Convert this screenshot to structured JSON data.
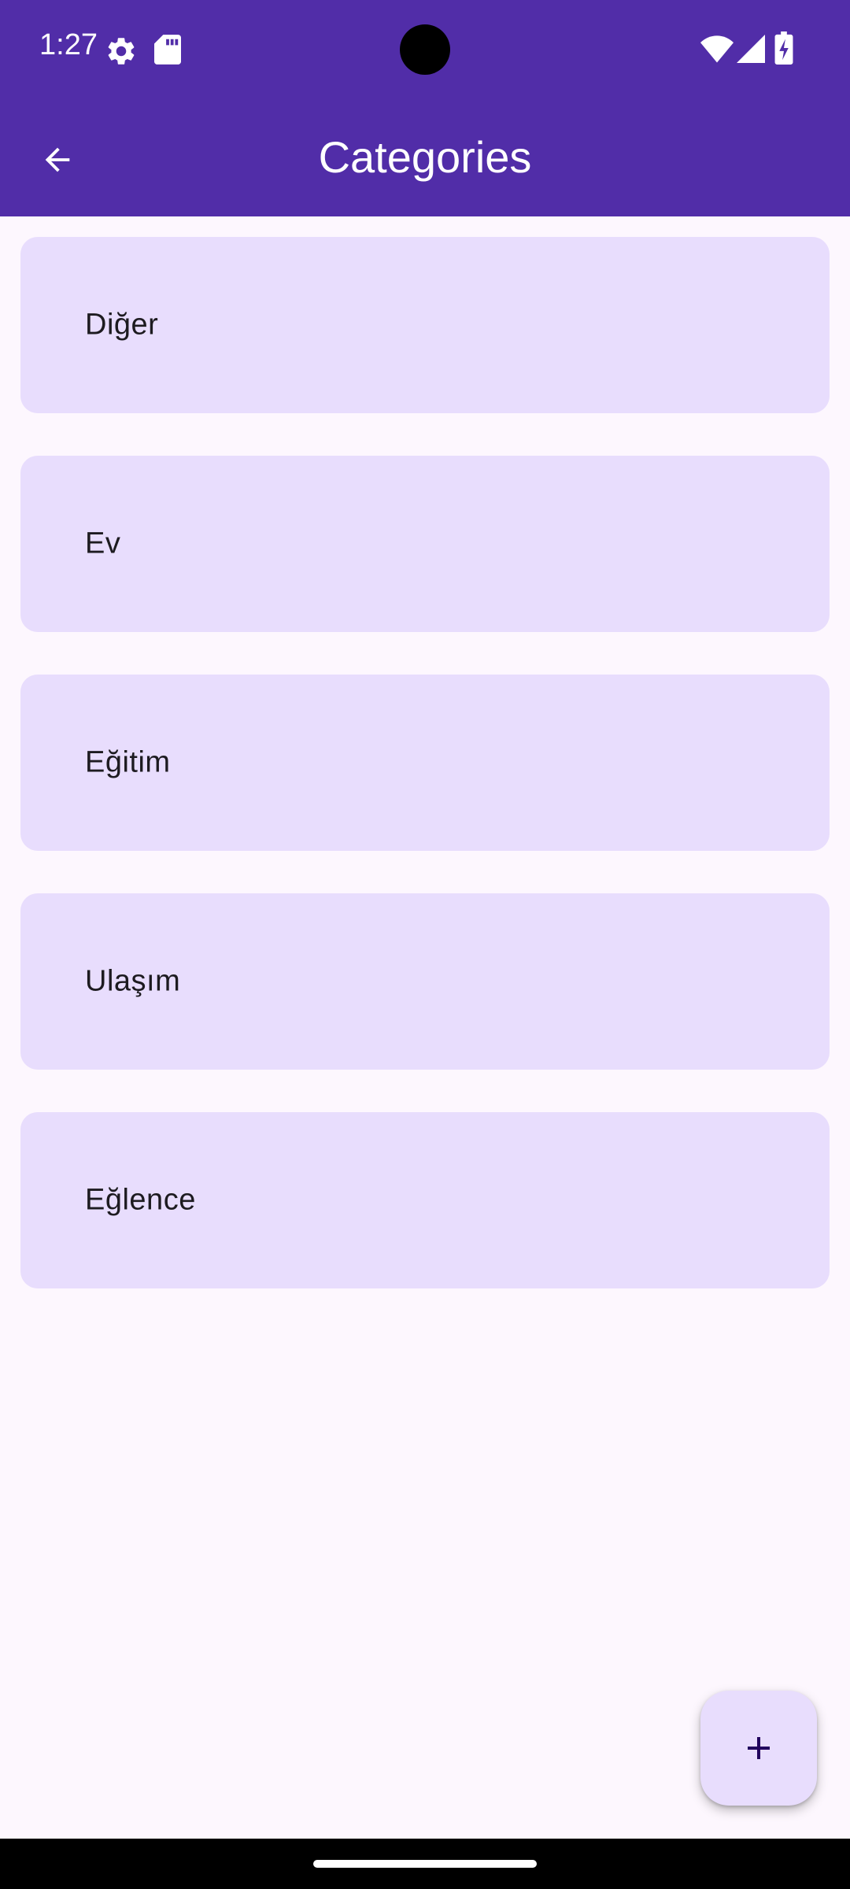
{
  "status_bar": {
    "time": "1:27",
    "icons": [
      "settings-gear-icon",
      "sd-card-icon",
      "wifi-icon",
      "cellular-signal-icon",
      "battery-charging-icon"
    ]
  },
  "app_bar": {
    "title": "Categories",
    "back_icon": "arrow-back-icon"
  },
  "categories": [
    {
      "label": "Diğer"
    },
    {
      "label": "Ev"
    },
    {
      "label": "Eğitim"
    },
    {
      "label": "Ulaşım"
    },
    {
      "label": "Eğlence"
    }
  ],
  "fab": {
    "icon": "add-icon"
  },
  "colors": {
    "primary": "#512DA8",
    "card_background": "#E8DDFD",
    "page_background": "#FDF7FE",
    "fab_icon": "#21005D"
  }
}
